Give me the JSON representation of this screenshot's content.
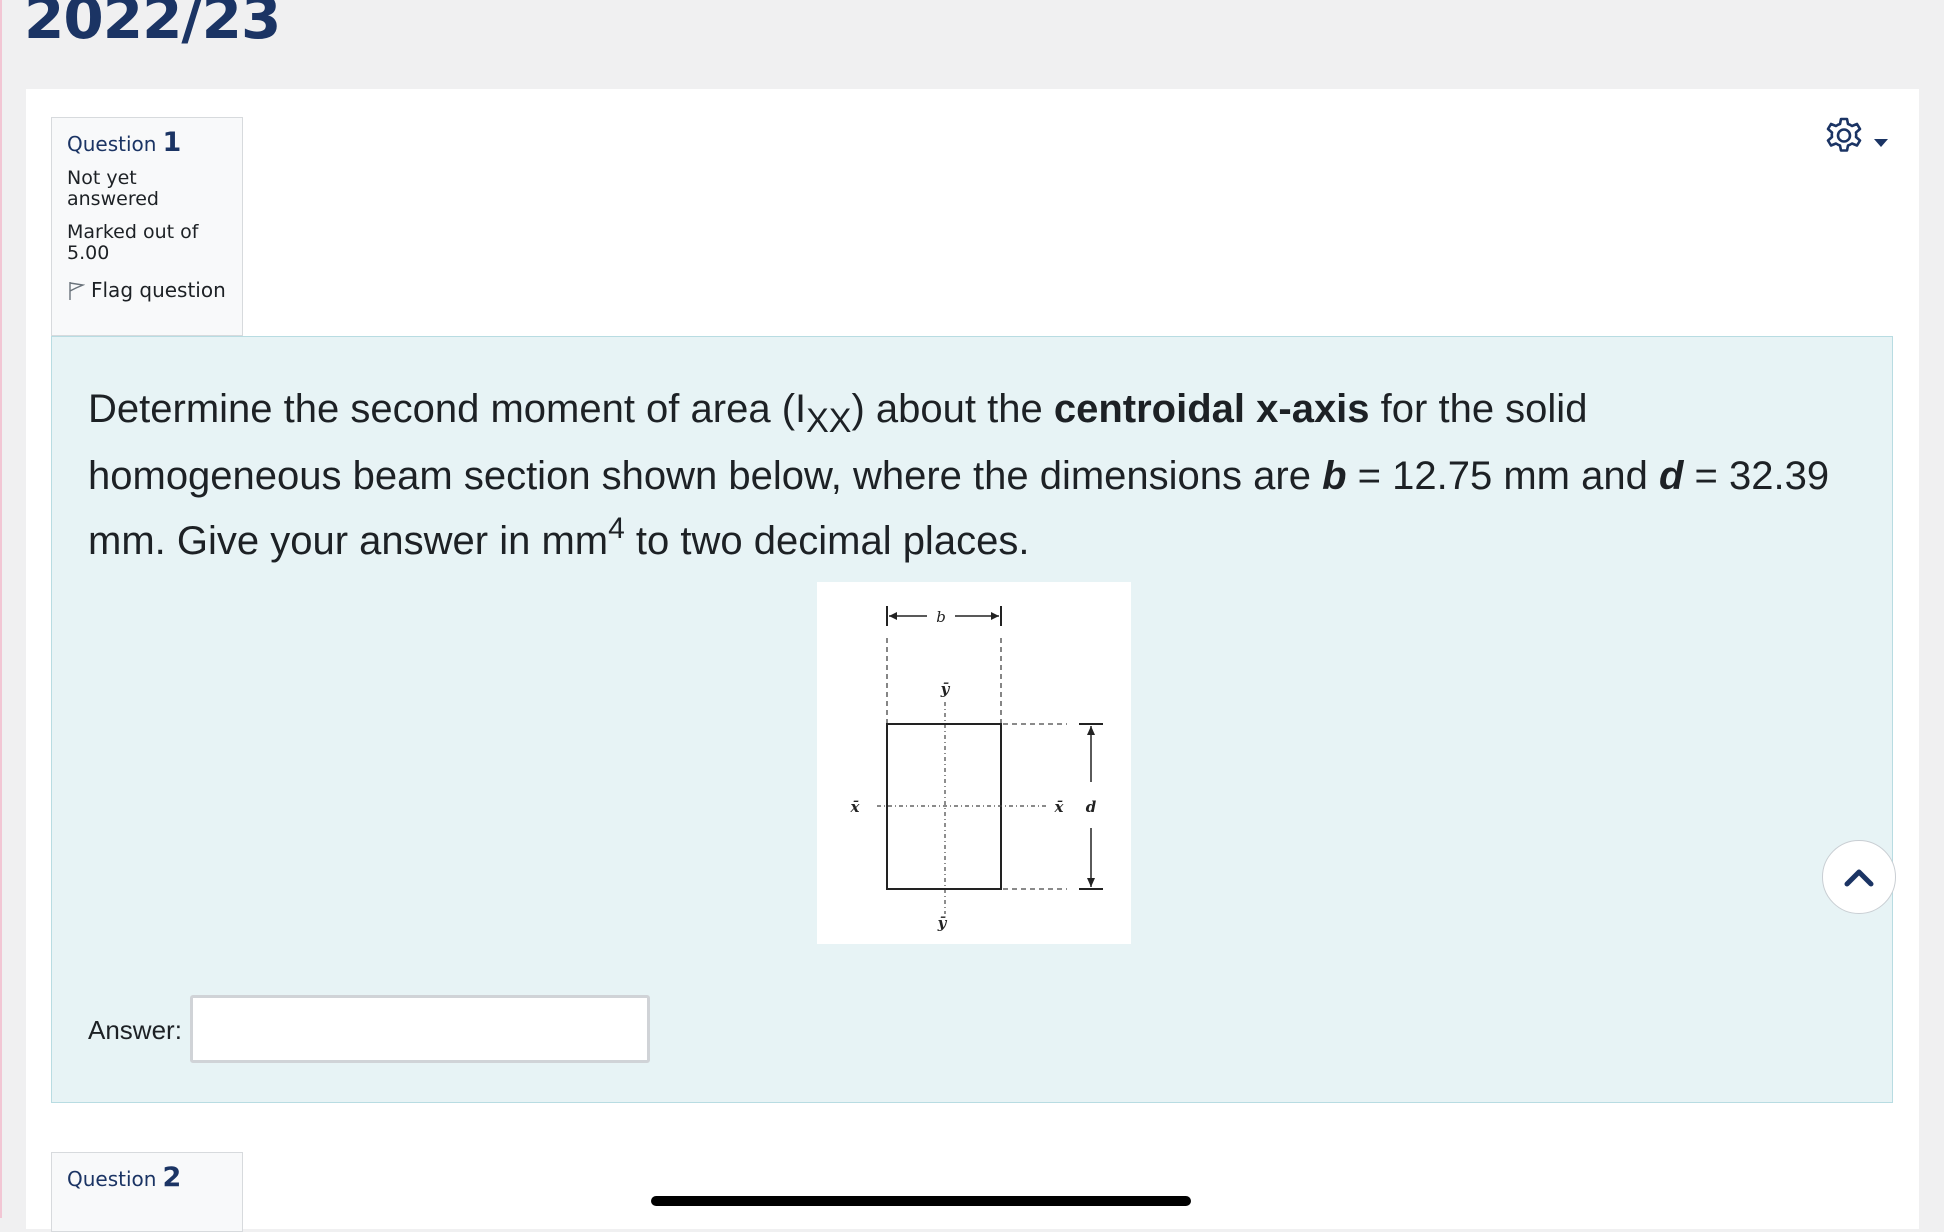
{
  "page": {
    "heading": "2022/23"
  },
  "questions": [
    {
      "label": "Question",
      "number": "1",
      "state": "Not yet answered",
      "mark": "Marked out of 5.00",
      "flag_label": "Flag question"
    },
    {
      "label": "Question",
      "number": "2"
    }
  ],
  "question1": {
    "text_part1": "Determine the second moment of area (I",
    "text_sub": "XX",
    "text_part2": ") about the ",
    "text_bold": "centroidal x-axis",
    "text_part3": " for the solid homogeneous beam section shown below, where the dimensions are ",
    "b_label": "b",
    "b_value": " = 12.75 mm and ",
    "d_label": "d",
    "d_value": " = 32.39 mm. Give your answer in mm",
    "text_sup": "4",
    "text_part4": " to two decimal places.",
    "diagram_labels": {
      "b": "b",
      "d": "d",
      "x": "x̄",
      "y": "ȳ"
    },
    "answer_label": "Answer:",
    "answer_value": ""
  },
  "icons": {
    "settings": "gear-icon",
    "dropdown": "caret-down-icon",
    "flag": "flag-icon",
    "back_to_top": "chevron-up-icon"
  },
  "colors": {
    "heading": "#1b3464",
    "formulation_bg": "#e7f3f5",
    "info_bg": "#f8f9fa"
  }
}
